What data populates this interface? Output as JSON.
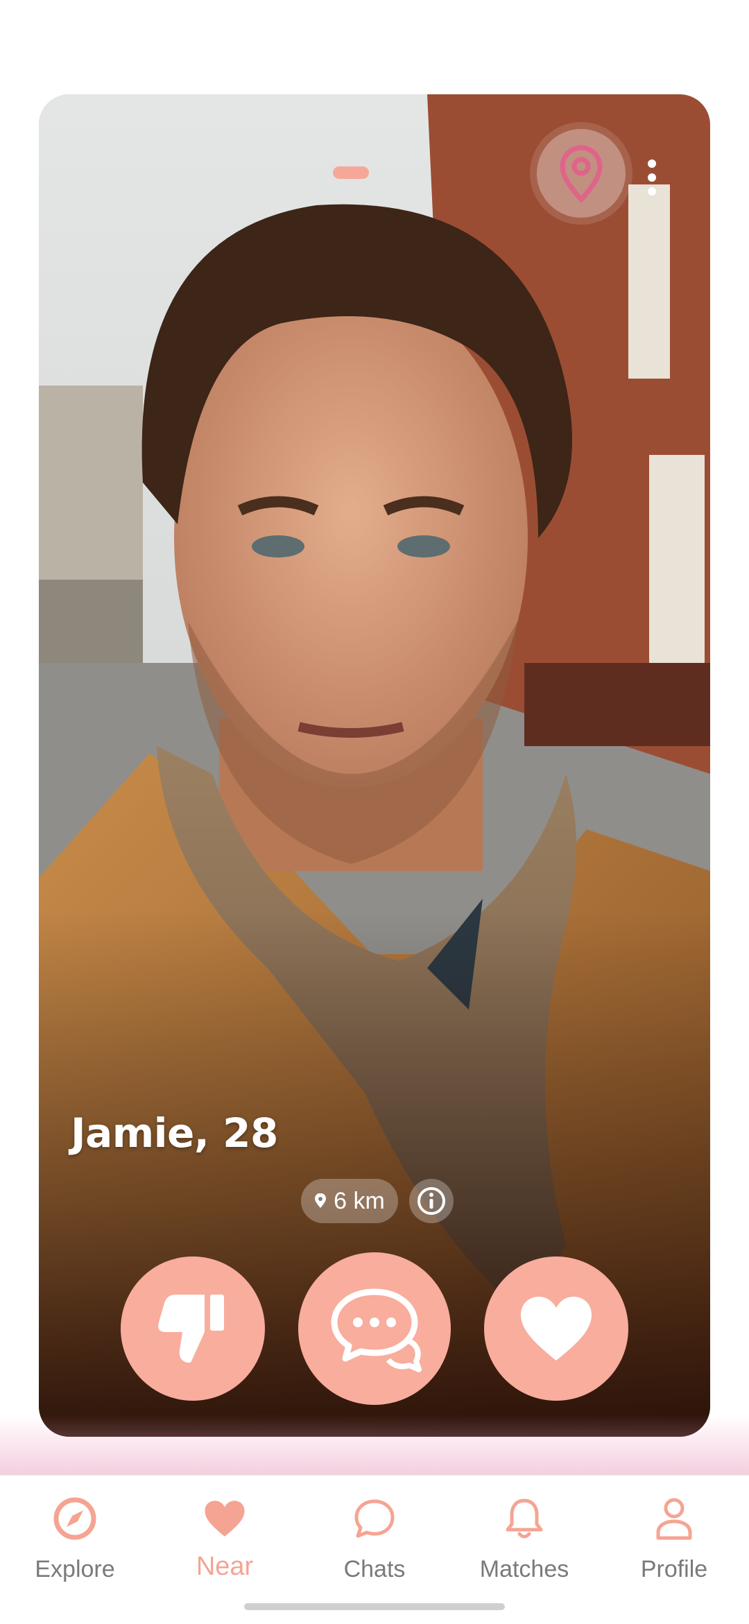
{
  "profile": {
    "name_age": "Jamie, 28",
    "distance": "6 km"
  },
  "actions": {
    "dislike_icon": "thumbs-down-icon",
    "message_icon": "chat-bubbles-icon",
    "like_icon": "heart-icon"
  },
  "nav": {
    "items": [
      {
        "label": "Explore",
        "icon": "compass-icon",
        "active": false
      },
      {
        "label": "Near",
        "icon": "heart-icon",
        "active": true
      },
      {
        "label": "Chats",
        "icon": "chat-bubble-icon",
        "active": false
      },
      {
        "label": "Matches",
        "icon": "bell-icon",
        "active": false
      },
      {
        "label": "Profile",
        "icon": "person-icon",
        "active": false
      }
    ]
  },
  "colors": {
    "accent": "#f8ad9d",
    "accent_text": "#f5a493",
    "location_pin": "#e0638a"
  }
}
